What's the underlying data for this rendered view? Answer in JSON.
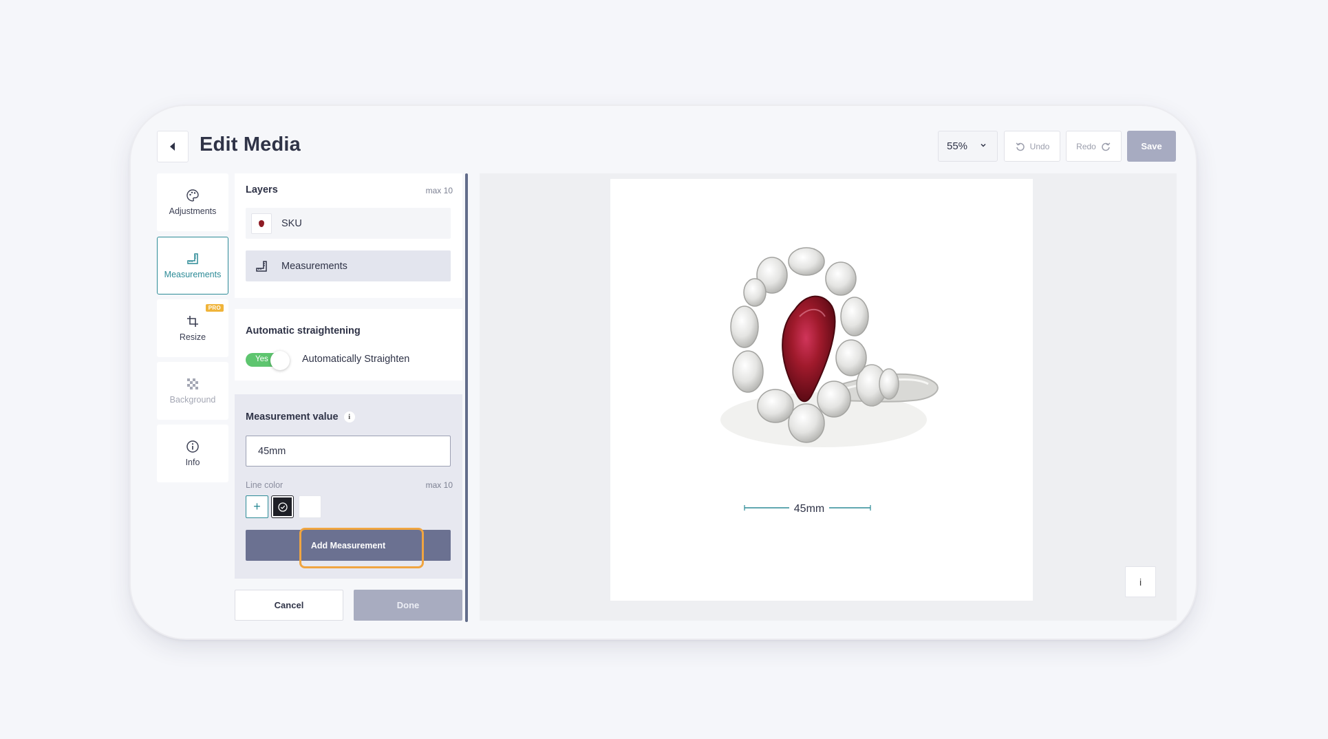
{
  "header": {
    "title": "Edit Media",
    "zoom": "55%",
    "undo_label": "Undo",
    "redo_label": "Redo",
    "save_label": "Save"
  },
  "rail": {
    "items": [
      {
        "label": "Adjustments",
        "icon": "palette-icon"
      },
      {
        "label": "Measurements",
        "icon": "ruler-icon",
        "active": true
      },
      {
        "label": "Resize",
        "icon": "crop-icon",
        "badge": "PRO"
      },
      {
        "label": "Background",
        "icon": "checkerboard-icon",
        "disabled": true
      },
      {
        "label": "Info",
        "icon": "info-icon"
      }
    ]
  },
  "layers": {
    "title": "Layers",
    "max": "max 10",
    "items": [
      {
        "label": "SKU",
        "icon": "image-thumbnail"
      },
      {
        "label": "Measurements",
        "icon": "ruler-icon",
        "selected": true
      }
    ]
  },
  "straightening": {
    "title": "Automatic straightening",
    "toggle_value": "Yes",
    "toggle_label": "Automatically Straighten"
  },
  "measurement": {
    "title": "Measurement value",
    "info_glyph": "i",
    "value": "45mm",
    "line_color_label": "Line color",
    "line_color_max": "max 10",
    "add_glyph": "+",
    "add_button": "Add Measurement",
    "colors": [
      "#1e1f26",
      "#ffffff"
    ]
  },
  "footer": {
    "cancel_label": "Cancel",
    "done_label": "Done"
  },
  "canvas": {
    "measure_label": "45mm",
    "info_glyph": "i"
  },
  "colors": {
    "accent": "#2b8a96",
    "toggle_on": "#5ec56f",
    "primary_button": "#6b7191",
    "highlight": "#f0a541",
    "disabled_button": "#a8acc0"
  }
}
